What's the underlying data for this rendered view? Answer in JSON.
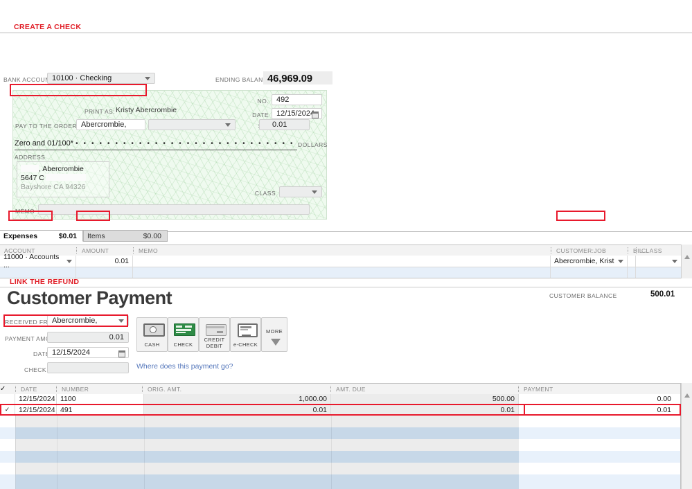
{
  "annotations": {
    "create_check": "CREATE A CHECK",
    "link_refund": "LINK THE REFUND",
    "accent_color": "#e8192c",
    "label_color": "#e01b24"
  },
  "check_section": {
    "bank_account_label": "BANK ACCOUNT",
    "bank_account_value": "10100 · Checking",
    "ending_balance_label": "ENDING BALANCE",
    "ending_balance_value": "46,969.09",
    "no_label": "NO.",
    "no_value": "492",
    "date_label": "DATE",
    "date_value": "12/15/2024",
    "print_as_label": "PRINT AS:",
    "print_as_value": "Kristy Abercrombie",
    "pay_to_label": "PAY TO THE ORDER OF",
    "pay_to_value": "Abercrombie,",
    "dollar_sign": "$",
    "amount_value": "0.01",
    "written_amount": "Zero and 01/100*",
    "dots": "• • • • • • • • • • • • • • • • • • • • • • • • • • • • • • • • • • • • • • • • • • • • • • • • •",
    "dollars_label": "DOLLARS",
    "address_label": "ADDRESS",
    "address_line1": ", Abercrombie",
    "address_line2": "5647 C",
    "address_line3": "Bayshore CA 94326",
    "class_label": "CLASS",
    "class_value": "",
    "memo_label": "MEMO",
    "memo_value": "",
    "calendar_icon": "calendar-icon",
    "dropdown_icon": "chevron-down-icon"
  },
  "expense_tabs": [
    {
      "label": "Expenses",
      "amount": "$0.01",
      "active": true
    },
    {
      "label": "Items",
      "amount": "$0.00",
      "active": false
    }
  ],
  "expense_grid": {
    "columns": [
      "ACCOUNT",
      "AMOUNT",
      "MEMO",
      "CUSTOMER:JOB",
      "BIL...",
      "CLASS"
    ],
    "rows": [
      {
        "account": "11000 · Accounts ...",
        "amount": "0.01",
        "memo": "",
        "customer_job": "Abercrombie, Krist",
        "billable": "",
        "class": ""
      },
      {
        "account": "",
        "amount": "",
        "memo": "",
        "customer_job": "",
        "billable": "",
        "class": ""
      }
    ]
  },
  "payment_section": {
    "title": "Customer Payment",
    "customer_balance_label": "CUSTOMER BALANCE",
    "customer_balance_value": "500.01",
    "received_from_label": "RECEIVED FROM",
    "received_from_value": "Abercrombie,",
    "payment_amount_label": "PAYMENT AMOUNT",
    "payment_amount_value": "0.01",
    "date_label": "DATE",
    "date_value": "12/15/2024",
    "check_no_label": "CHECK #",
    "check_no_value": "",
    "help_link": "Where does this payment go?",
    "methods": [
      {
        "name": "CASH",
        "icon": "cash-icon",
        "selected": false
      },
      {
        "name": "CHECK",
        "icon": "check-icon",
        "selected": true
      },
      {
        "name": "CREDIT DEBIT",
        "line1": "CREDIT",
        "line2": "DEBIT",
        "icon": "credit-card-icon",
        "selected": false
      },
      {
        "name": "e-CHECK",
        "icon": "echeck-icon",
        "selected": false
      },
      {
        "name": "MORE",
        "icon": "chevron-down-icon",
        "selected": false
      }
    ]
  },
  "invoice_grid": {
    "columns": [
      "✓",
      "DATE",
      "NUMBER",
      "ORIG. AMT.",
      "AMT. DUE",
      "PAYMENT"
    ],
    "rows": [
      {
        "checked": "",
        "date": "12/15/2024",
        "number": "1100",
        "orig_amt": "1,000.00",
        "amt_due": "500.00",
        "payment": "0.00",
        "highlighted": false
      },
      {
        "checked": "✓",
        "date": "12/15/2024",
        "number": "491",
        "orig_amt": "0.01",
        "amt_due": "0.01",
        "payment": "0.01",
        "highlighted": true
      }
    ]
  }
}
